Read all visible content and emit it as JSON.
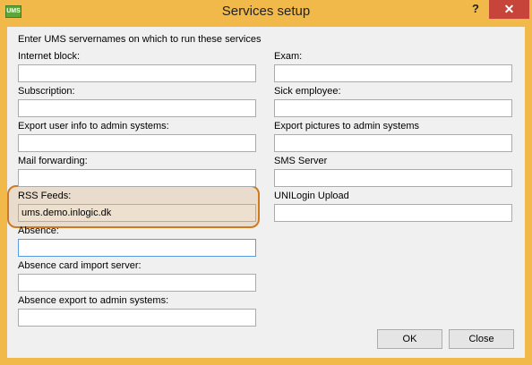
{
  "window": {
    "title": "Services setup",
    "app_icon": "UMS",
    "help": "?",
    "close": "✕"
  },
  "intro": "Enter UMS servernames on which to run these services",
  "left_fields": [
    {
      "label": "Internet block:",
      "value": ""
    },
    {
      "label": "Subscription:",
      "value": ""
    },
    {
      "label": "Export user info to admin systems:",
      "value": ""
    },
    {
      "label": "Mail forwarding:",
      "value": ""
    },
    {
      "label": "RSS Feeds:",
      "value": "ums.demo.inlogic.dk"
    },
    {
      "label": "Absence:",
      "value": ""
    },
    {
      "label": "Absence card import server:",
      "value": ""
    },
    {
      "label": "Absence export to admin systems:",
      "value": ""
    }
  ],
  "right_fields": [
    {
      "label": "Exam:",
      "value": ""
    },
    {
      "label": "Sick employee:",
      "value": ""
    },
    {
      "label": "Export pictures to admin systems",
      "value": ""
    },
    {
      "label": "SMS Server",
      "value": ""
    },
    {
      "label": "UNILogin Upload",
      "value": ""
    }
  ],
  "buttons": {
    "ok": "OK",
    "close": "Close"
  },
  "colors": {
    "frame": "#f0b94a",
    "highlight_border": "#d07a1e",
    "close_button": "#c7443a"
  }
}
